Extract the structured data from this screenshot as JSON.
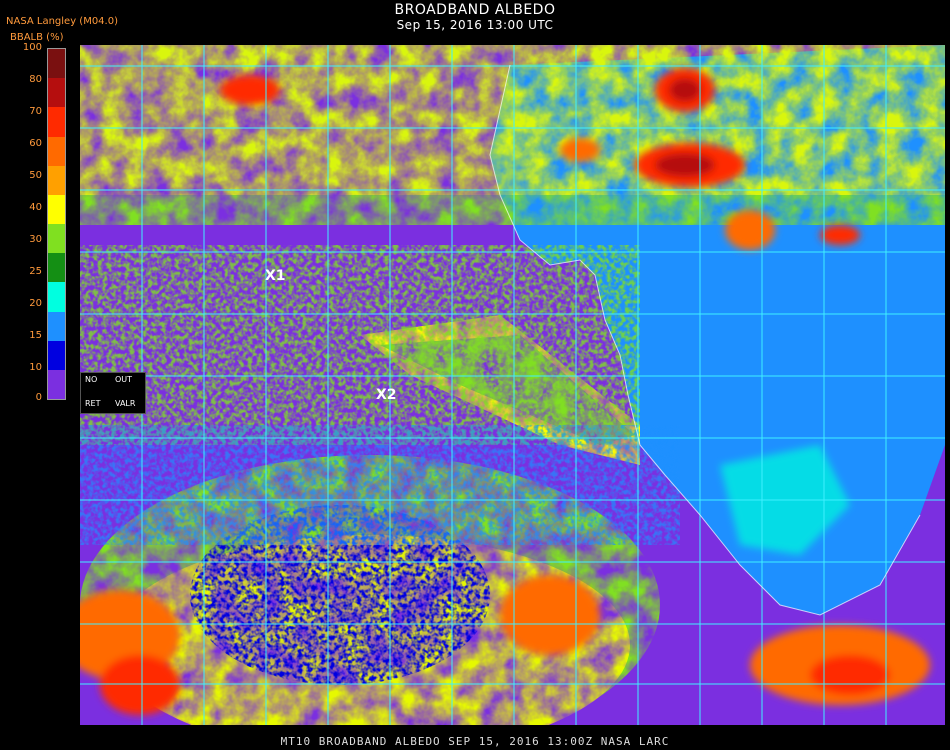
{
  "title": "BROADBAND ALBEDO",
  "subtitle": "Sep 15, 2016 13:00 UTC",
  "brand": "NASA Langley (M04.0)",
  "colorbar": {
    "label": "BBALB (%)",
    "ticks": [
      "100",
      "80",
      "70",
      "60",
      "50",
      "40",
      "30",
      "25",
      "20",
      "15",
      "10",
      "0"
    ],
    "colors": [
      "#7a1010",
      "#b50e0e",
      "#ff2a00",
      "#ff6a00",
      "#ffa000",
      "#ffff00",
      "#80e020",
      "#148f14",
      "#00ffe0",
      "#1e90ff",
      "#0000e0",
      "#7b2fe0"
    ]
  },
  "legend": {
    "no": "NO",
    "out": "OUT",
    "ret": "RET",
    "valr": "VALR"
  },
  "markers": {
    "x1": "X1",
    "x2": "X2"
  },
  "footer": "MT10  BROADBAND ALBEDO  SEP 15, 2016 13:00Z  NASA LARC"
}
